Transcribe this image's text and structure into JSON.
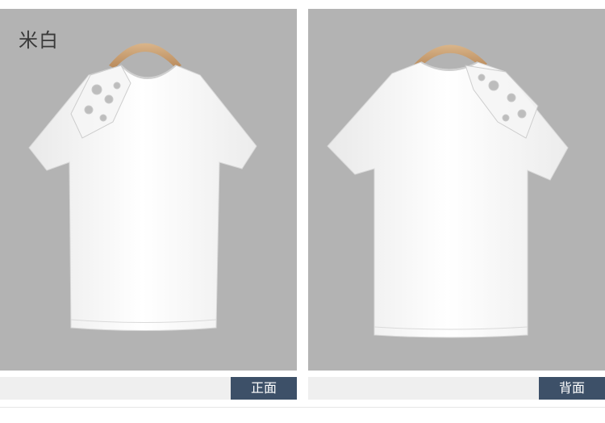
{
  "color_label": "米白",
  "views": {
    "front_label": "正面",
    "back_label": "背面"
  },
  "colors": {
    "panel_bg": "#b3b3b3",
    "tag_bg": "#3d5068",
    "bar_bg": "#efefef"
  }
}
